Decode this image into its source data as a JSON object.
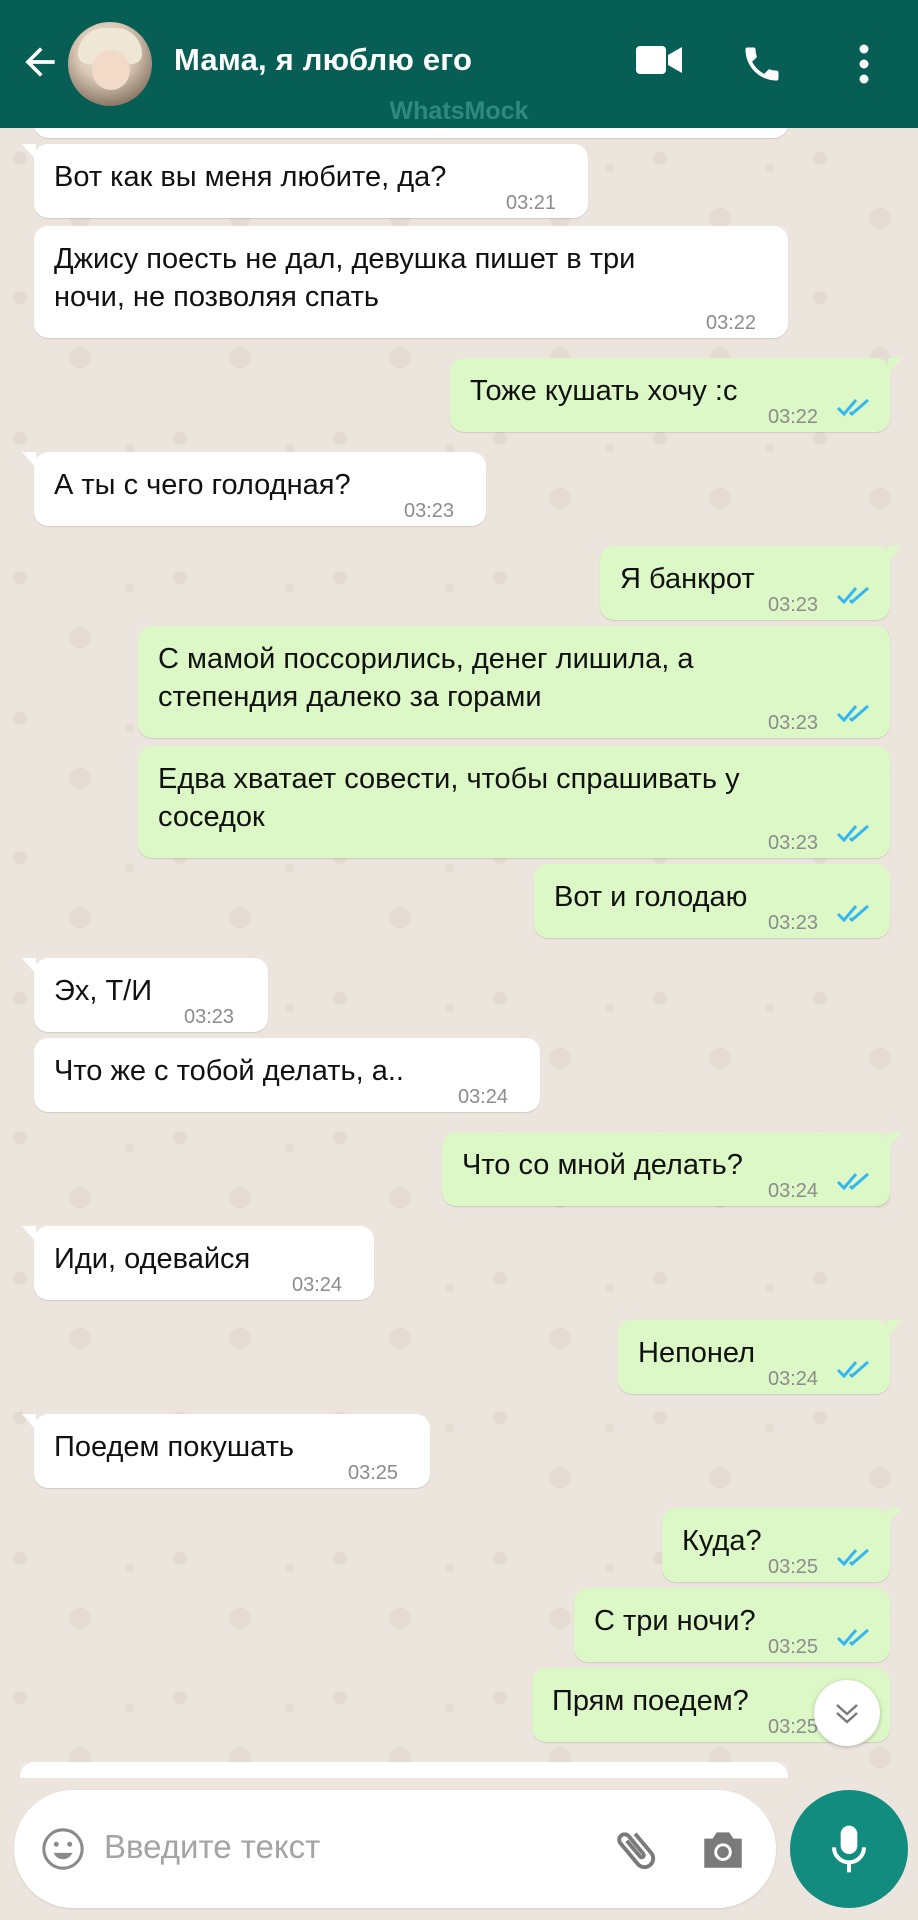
{
  "header": {
    "title": "Мама, я люблю его",
    "watermark": "WhatsMock"
  },
  "colors": {
    "header": "#075e54",
    "incoming": "#ffffff",
    "outgoing": "#dcf8c6",
    "tick": "#34b7f1",
    "mic": "#128c7e"
  },
  "messages": [
    {
      "dir": "in",
      "text": "Вот как вы меня любите, да?",
      "time": "03:21"
    },
    {
      "dir": "in",
      "text": "Джису поесть не дал, девушка пишет в три\nночи, не позволяя спать",
      "time": "03:22"
    },
    {
      "dir": "out",
      "text": "Тоже кушать хочу :с",
      "time": "03:22"
    },
    {
      "dir": "in",
      "text": "А ты с чего голодная?",
      "time": "03:23"
    },
    {
      "dir": "out",
      "text": "Я банкрот",
      "time": "03:23"
    },
    {
      "dir": "out",
      "text": "С мамой поссорились, денег лишила, а\nстепендия далеко за горами",
      "time": "03:23"
    },
    {
      "dir": "out",
      "text": "Едва хватает совести, чтобы спрашивать у\nсоседок",
      "time": "03:23"
    },
    {
      "dir": "out",
      "text": "Вот и голодаю",
      "time": "03:23"
    },
    {
      "dir": "in",
      "text": "Эх, Т/И",
      "time": "03:23"
    },
    {
      "dir": "in",
      "text": "Что же с тобой делать, а..",
      "time": "03:24"
    },
    {
      "dir": "out",
      "text": "Что со мной делать?",
      "time": "03:24"
    },
    {
      "dir": "in",
      "text": "Иди, одевайся",
      "time": "03:24"
    },
    {
      "dir": "out",
      "text": "Непонел",
      "time": "03:24"
    },
    {
      "dir": "in",
      "text": "Поедем покушать",
      "time": "03:25"
    },
    {
      "dir": "out",
      "text": "Куда?",
      "time": "03:25"
    },
    {
      "dir": "out",
      "text": "С три ночи?",
      "time": "03:25"
    },
    {
      "dir": "out",
      "text": "Прям поедем?",
      "time": "03:25"
    }
  ],
  "input": {
    "placeholder": "Введите текст"
  },
  "icons": [
    "back-arrow-icon",
    "video-call-icon",
    "phone-icon",
    "more-vert-icon",
    "emoji-icon",
    "attach-icon",
    "camera-icon",
    "mic-icon",
    "scroll-down-icon",
    "double-check-icon"
  ]
}
